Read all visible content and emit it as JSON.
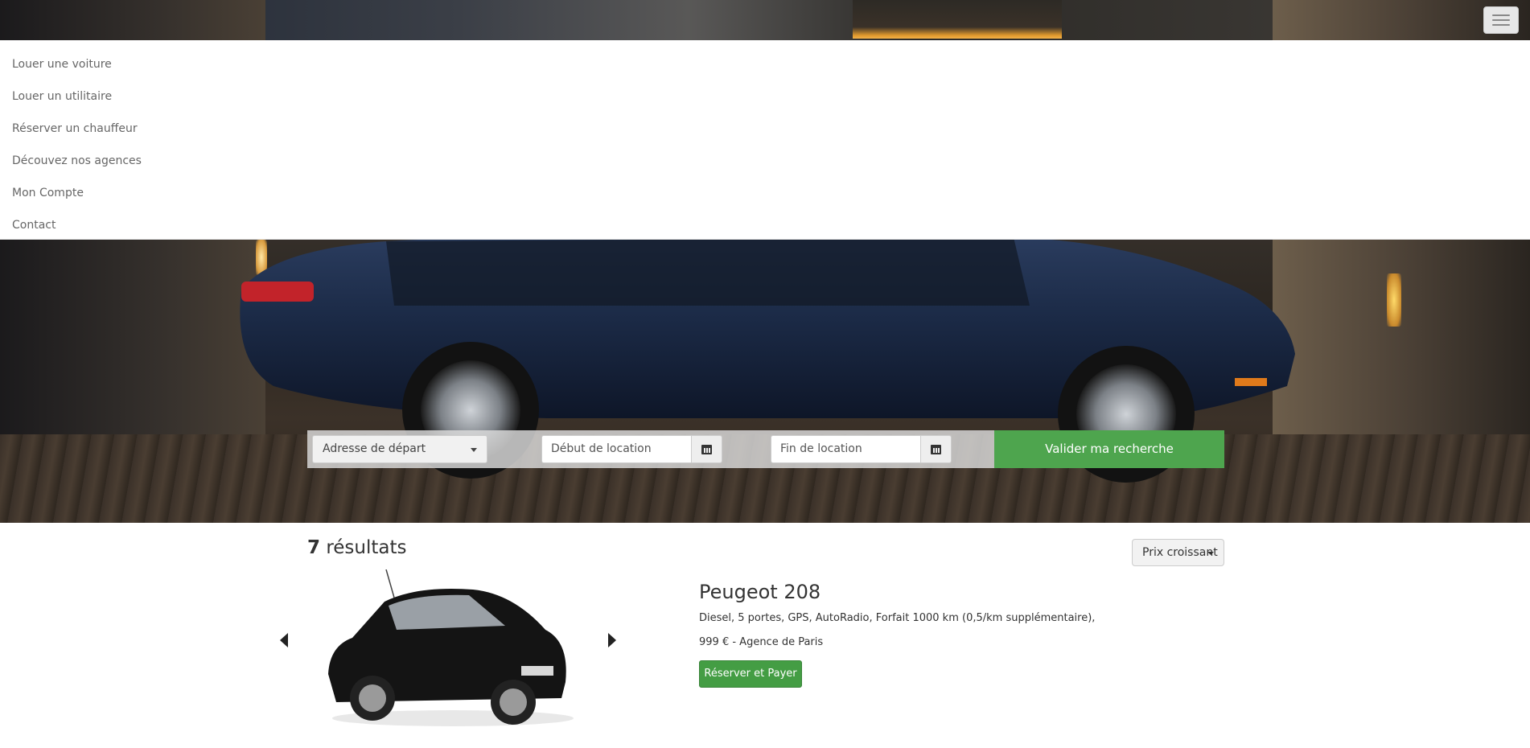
{
  "menu": {
    "items": [
      {
        "label": "Louer une voiture"
      },
      {
        "label": "Louer un utilitaire"
      },
      {
        "label": "Réserver un chauffeur"
      },
      {
        "label": "Découvez nos agences"
      },
      {
        "label": "Mon Compte"
      },
      {
        "label": "Contact"
      }
    ],
    "toggle_icon": "hamburger-icon"
  },
  "search": {
    "departure_select": "Adresse de départ",
    "start_date_placeholder": "Début de location",
    "end_date_placeholder": "Fin de location",
    "calendar_icon": "calendar-icon",
    "submit_label": "Valider ma recherche",
    "submit_color": "#4ea54e"
  },
  "results": {
    "count": "7",
    "count_suffix": " résultats",
    "sort_label": "Prix croissant"
  },
  "listing": {
    "title": "Peugeot 208",
    "description": "Diesel, 5 portes, GPS, AutoRadio, Forfait 1000 km (0,5/km supplémentaire),",
    "price_line": "999 € - Agence de Paris",
    "book_label": "Réserver et Payer",
    "book_color": "#449d44"
  }
}
